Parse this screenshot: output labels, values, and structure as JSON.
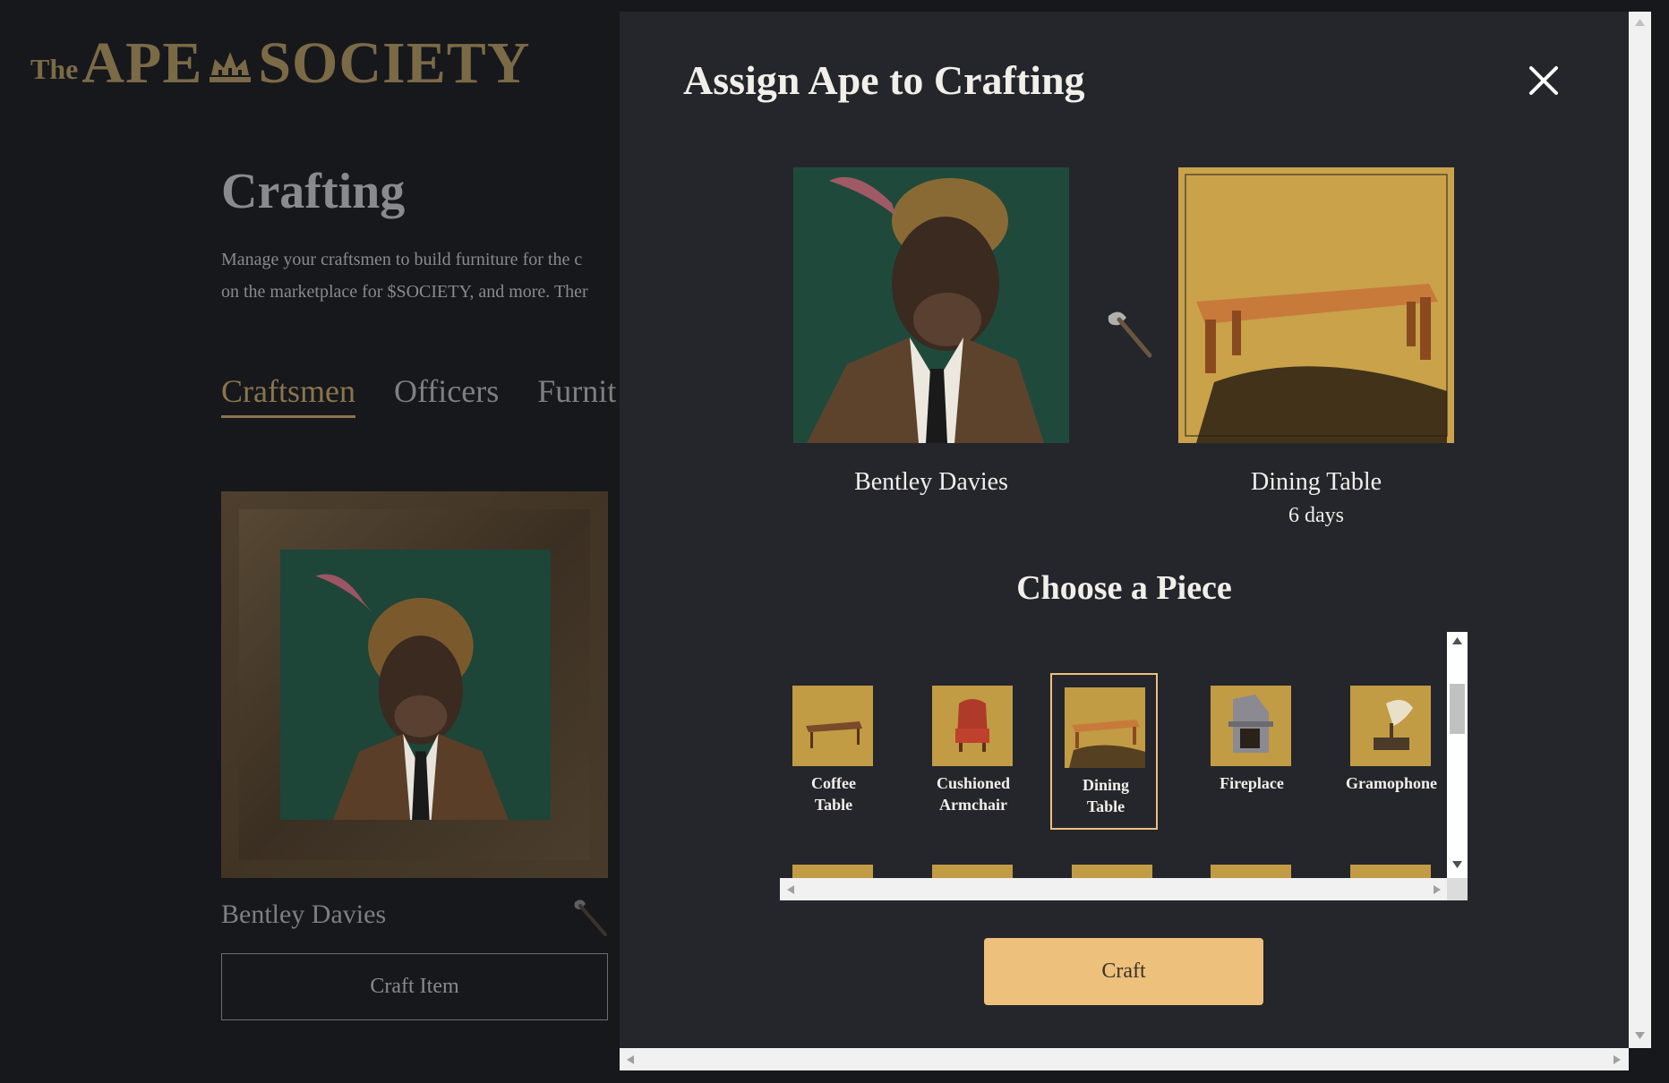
{
  "brand": {
    "the": "The",
    "ape": "APE",
    "society": "SOCIETY"
  },
  "background": {
    "title": "Crafting",
    "description_line1": "Manage your craftsmen to build furniture for the c",
    "description_line2": "on the marketplace for $SOCIETY, and more. Ther",
    "tabs": [
      {
        "label": "Craftsmen",
        "active": true
      },
      {
        "label": "Officers",
        "active": false
      },
      {
        "label": "Furnit",
        "active": false
      }
    ],
    "card": {
      "name": "Bentley Davies",
      "button_label": "Craft Item"
    }
  },
  "modal": {
    "title": "Assign Ape to Crafting",
    "ape": {
      "name": "Bentley Davies"
    },
    "item": {
      "name": "Dining Table",
      "duration": "6 days"
    },
    "choose_title": "Choose a Piece",
    "pieces": [
      {
        "label_line1": "Coffee",
        "label_line2": "Table",
        "selected": false
      },
      {
        "label_line1": "Cushioned",
        "label_line2": "Armchair",
        "selected": false
      },
      {
        "label_line1": "Dining",
        "label_line2": "Table",
        "selected": true
      },
      {
        "label_line1": "Fireplace",
        "label_line2": "",
        "selected": false
      },
      {
        "label_line1": "Gramophone",
        "label_line2": "",
        "selected": false
      }
    ],
    "craft_label": "Craft"
  },
  "colors": {
    "accent": "#edc07b",
    "brand_gold": "#7b6a46",
    "modal_bg": "#24262c",
    "page_bg": "#16181c"
  }
}
